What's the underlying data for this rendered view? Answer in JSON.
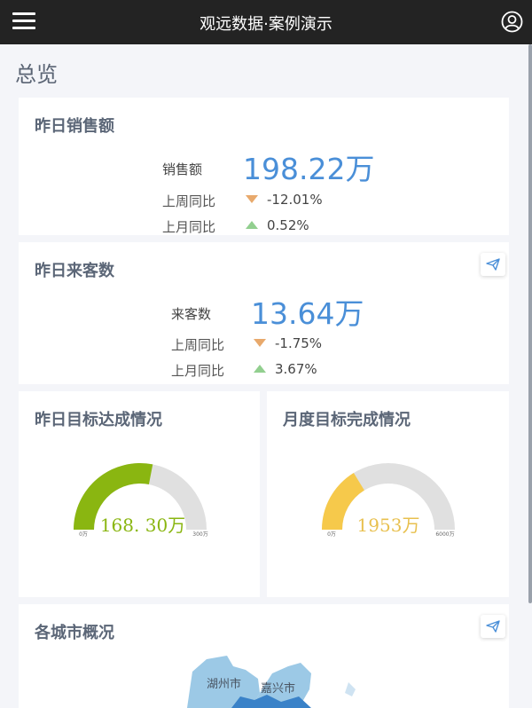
{
  "header": {
    "title": "观远数据·案例演示",
    "menu_icon": "hamburger-menu-icon",
    "user_icon": "user-circle-icon"
  },
  "page": {
    "title": "总览"
  },
  "colors": {
    "accent": "#4a8fd8",
    "down": "#e8a96c",
    "up": "#92cf8f",
    "gauge1": "#8ab611",
    "gauge2": "#f6c94b",
    "track": "#e0e0e0"
  },
  "sales_card": {
    "title": "昨日销售额",
    "metric_label": "销售额",
    "metric_value": "198.22万",
    "week_label": "上周同比",
    "week_value": "-12.01%",
    "month_label": "上月同比",
    "month_value": "0.52%"
  },
  "visitors_card": {
    "title": "昨日来客数",
    "metric_label": "来客数",
    "metric_value": "13.64万",
    "week_label": "上周同比",
    "week_value": "-1.75%",
    "month_label": "上月同比",
    "month_value": "3.67%",
    "share_icon": "send-icon"
  },
  "daily_target": {
    "title": "昨日目标达成情况",
    "value_label": "168. 30万",
    "min_label": "0万",
    "max_label": "300万",
    "value": 168.3,
    "min": 0,
    "max": 300
  },
  "monthly_target": {
    "title": "月度目标完成情况",
    "value_label": "1953万",
    "min_label": "0万",
    "max_label": "6000万",
    "value": 1953,
    "min": 0,
    "max": 6000
  },
  "city_card": {
    "title": "各城市概况",
    "share_icon": "send-icon",
    "cities": [
      "湖州市",
      "嘉兴市"
    ]
  }
}
